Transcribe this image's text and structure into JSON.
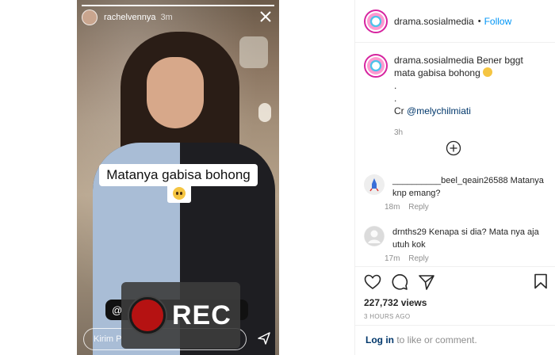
{
  "story": {
    "username": "rachelvennya",
    "time": "3m",
    "progress_fraction": 1.0,
    "caption": "Matanya gabisa bohong",
    "mention_prefix": "@",
    "reply_placeholder": "Kirim P",
    "rec_label": "REC"
  },
  "post": {
    "account": "drama.sosialmedia",
    "separator": "•",
    "follow_label": "Follow",
    "caption_text": "Bener bggt mata gabisa bohong",
    "dot1": ".",
    "dot2": ".",
    "credit_prefix": "Cr",
    "credit_mention": "@melychilmiati",
    "posted_ago": "3h"
  },
  "comments": [
    {
      "username": "__________beel_qeain26588",
      "text": "Matanya knp emang?",
      "time": "18m",
      "reply_label": "Reply"
    },
    {
      "username": "drnths29",
      "text": "Kenapa si dia? Mata nya aja utuh kok",
      "time": "17m",
      "reply_label": "Reply"
    }
  ],
  "stats": {
    "views": "227,732 views",
    "timestamp": "3 HOURS AGO"
  },
  "login": {
    "link_label": "Log in",
    "rest_text": " to like or comment."
  },
  "colors": {
    "link_blue": "#0095f6",
    "mention_blue": "#00376b",
    "rec_red": "#b51212"
  },
  "icons": [
    "close-icon",
    "send-icon",
    "add-comment-icon",
    "heart-icon",
    "comment-icon",
    "share-icon",
    "bookmark-icon"
  ]
}
